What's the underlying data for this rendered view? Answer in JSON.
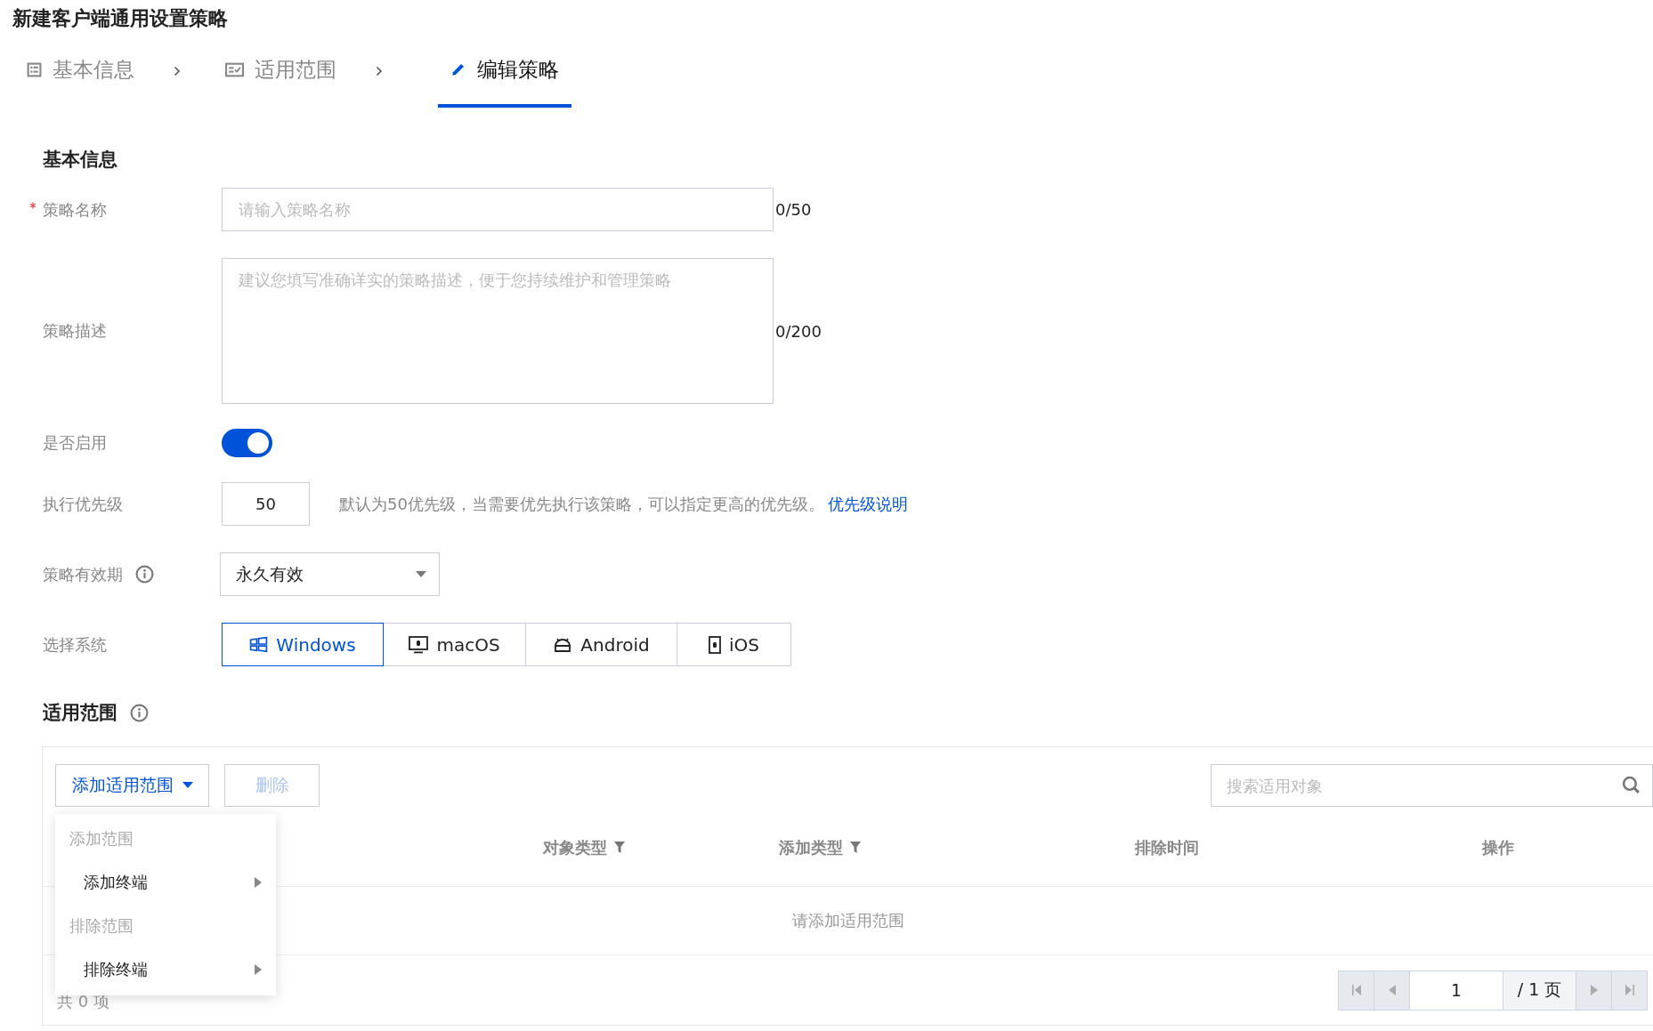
{
  "page_title": "新建客户端通用设置策略",
  "steps": [
    {
      "label": "基本信息",
      "selected": false
    },
    {
      "label": "适用范围",
      "selected": false
    },
    {
      "label": "编辑策略",
      "selected": true
    }
  ],
  "basic": {
    "title": "基本信息",
    "name": {
      "label": "策略名称",
      "required": true,
      "placeholder": "请输入策略名称",
      "counter": "0/50"
    },
    "description": {
      "label": "策略描述",
      "placeholder": "建议您填写准确详实的策略描述，便于您持续维护和管理策略",
      "counter": "0/200"
    },
    "enabled": {
      "label": "是否启用",
      "on": true
    },
    "priority": {
      "label": "执行优先级",
      "value": "50",
      "hint": "默认为50优先级，当需要优先执行该策略，可以指定更高的优先级。",
      "link": "优先级说明"
    },
    "validity": {
      "label": "策略有效期",
      "value": "永久有效"
    },
    "system": {
      "label": "选择系统",
      "options": [
        {
          "label": "Windows",
          "selected": true
        },
        {
          "label": "macOS",
          "selected": false
        },
        {
          "label": "Android",
          "selected": false
        },
        {
          "label": "iOS",
          "selected": false
        }
      ]
    }
  },
  "scope": {
    "title": "适用范围",
    "add_button": "添加适用范围",
    "delete_button": {
      "label": "删除",
      "disabled": true
    },
    "search": {
      "placeholder": "搜索适用对象"
    },
    "menu": [
      {
        "kind": "group",
        "label": "添加范围"
      },
      {
        "kind": "item",
        "label": "添加终端"
      },
      {
        "kind": "group",
        "label": "排除范围"
      },
      {
        "kind": "item",
        "label": "排除终端"
      }
    ],
    "columns": [
      {
        "label": "对象类型",
        "kind": "filterable"
      },
      {
        "label": "添加类型",
        "kind": "filterable"
      },
      {
        "label": "排除时间",
        "kind": "plain"
      },
      {
        "label": "操作",
        "kind": "plain"
      }
    ],
    "empty_text": "请添加适用范围",
    "total": "共 0 项",
    "pagination": {
      "page": "1",
      "pages": "/ 1 页"
    }
  }
}
